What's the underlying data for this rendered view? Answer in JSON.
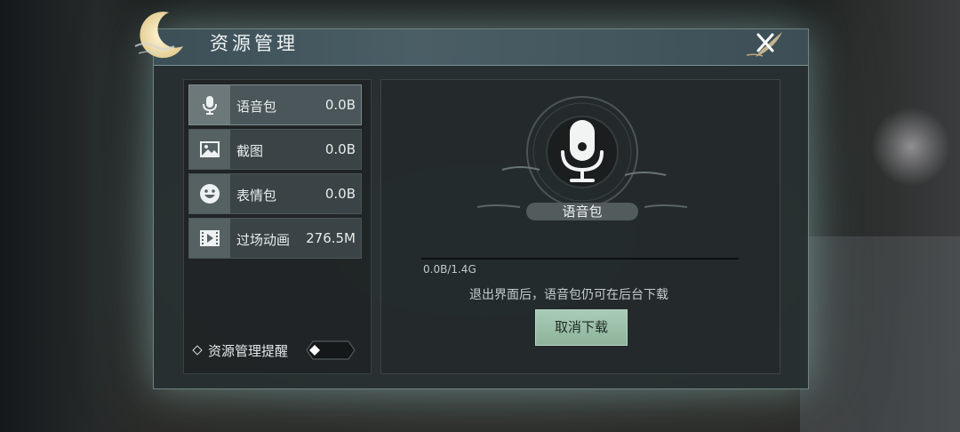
{
  "dialog": {
    "title": "资源管理",
    "close_icon": "close-x-icon"
  },
  "resources": [
    {
      "label": "语音包",
      "size": "0.0B",
      "icon": "microphone-icon",
      "active": true
    },
    {
      "label": "截图",
      "size": "0.0B",
      "icon": "image-icon",
      "active": false
    },
    {
      "label": "表情包",
      "size": "0.0B",
      "icon": "smiley-icon",
      "active": false
    },
    {
      "label": "过场动画",
      "size": "276.5M",
      "icon": "film-icon",
      "active": false
    }
  ],
  "reminder": {
    "label": "资源管理提醒",
    "enabled": false
  },
  "download": {
    "title": "语音包",
    "progress_text": "0.0B/1.4G",
    "progress": 0,
    "hint": "退出界面后，语音包仍可在后台下载",
    "cancel_label": "取消下载"
  },
  "colors": {
    "accent_button": "#9fc3ab",
    "panel": "#283031"
  }
}
